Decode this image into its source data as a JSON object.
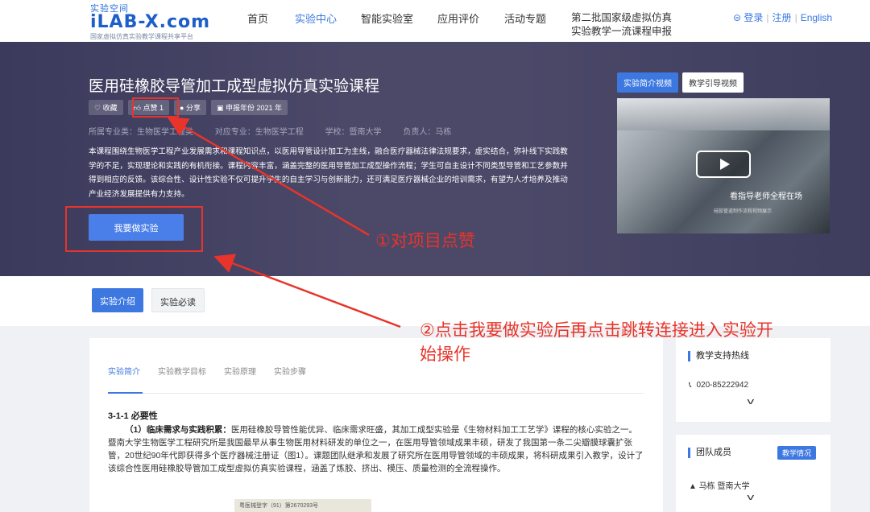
{
  "logo": {
    "top": "实验空间",
    "main": "iLAB-X.com",
    "sub": "国家虚拟仿真实验教学课程共享平台"
  },
  "nav": {
    "items": [
      "首页",
      "实验中心",
      "智能实验室",
      "应用评价",
      "活动专题"
    ],
    "multi_line1": "第二批国家级虚拟仿真",
    "multi_line2": "实验教学一流课程申报",
    "login": "登录",
    "register": "注册",
    "language": "English"
  },
  "hero": {
    "title": "医用硅橡胶导管加工成型虚拟仿真实验课程",
    "tags": [
      "收藏",
      "点赞 1",
      "分享",
      "申报年份 2021 年"
    ],
    "meta": [
      "所属专业类：生物医学工程类",
      "对应专业：生物医学工程",
      "学校：暨南大学",
      "负责人：马栋"
    ],
    "description": "本课程围绕生物医学工程产业发展需求和课程知识点，以医用导管设计加工为主线，融合医疗器械法律法规要求，虚实结合，弥补线下实践教学的不足，实现理论和实践的有机衔接。课程内容丰富，涵盖完整的医用导管加工成型操作流程；学生可自主设计不同类型导管和工艺参数并得到相应的反馈。该综合性、设计性实验不仅可提升学生的自主学习与创新能力，还可满足医疗器械企业的培训需求，有望为人才培养及推动产业经济发展提供有力支持。",
    "start_button": "我要做实验",
    "video_tabs": [
      "实验简介视频",
      "教学引导视频"
    ],
    "video_caption": "看指导老师全程在场",
    "video_caption_small": "硅胶管道制作流程视频展示"
  },
  "subtabs": [
    "实验介绍",
    "实验必读"
  ],
  "content": {
    "tabs": [
      "实验简介",
      "实验教学目标",
      "实验原理",
      "实验步骤"
    ],
    "section_heading": "3-1-1 必要性",
    "para_lead": "（1）临床需求与实践积累：",
    "para_body": "医用硅橡胶导管性能优异、临床需求旺盛，其加工成型实验是《生物材料加工工艺学》课程的核心实验之一。暨南大学生物医学工程研究所是我国最早从事生物医用材料研发的单位之一，在医用导管领域成果丰硕，研发了我国第一条二尖瓣膜球囊扩张管，20世纪90年代即获得多个医疗器械注册证（图1）。课题团队继承和发展了研究所在医用导管领域的丰硕成果，将科研成果引入教学，设计了该综合性医用硅橡胶导管加工成型虚拟仿真实验课程，涵盖了炼胶、挤出、模压、质量检测的全流程操作。",
    "doc_caption": "粤医械登字（91）第2670293号"
  },
  "panels": {
    "hotline_title": "教学支持热线",
    "hotline_phone": "020-85222942",
    "team_title": "团队成员",
    "team_badge": "教学情况",
    "member": "马栋   暨南大学"
  },
  "annotations": {
    "a1": "①对项目点赞",
    "a2_line1": "②点击我要做实验后再点击跳转连接进入实验开",
    "a2_line2": "始操作"
  },
  "colors": {
    "accent": "#3c78e0",
    "annotation": "#e8342a",
    "hero_bg": "#4b4868"
  }
}
